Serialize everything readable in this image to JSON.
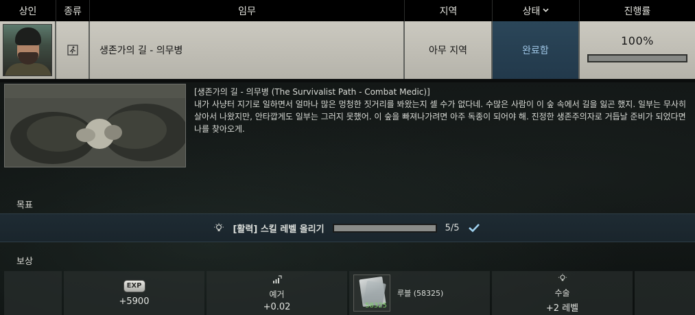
{
  "header": {
    "trader": "상인",
    "type": "종류",
    "task": "임무",
    "location": "지역",
    "status": "상태",
    "progress": "진행률"
  },
  "quest": {
    "type_icon": "exit-run-icon",
    "name": "생존가의 길 - 의무병",
    "location": "아무 지역",
    "status": "완료함",
    "progress_text": "100%",
    "progress_fraction": 1.0
  },
  "description": {
    "title": "[생존가의 길 - 의무병 (The Survivalist Path - Combat Medic)]",
    "body": "내가 사냥터 지기로 일하면서 얼마나 많은 멍청한 짓거리를 봐왔는지 셀 수가 없다네. 수많은 사람이 이 숲 속에서 길을 잃곤 했지. 일부는 무사히 살아서 나왔지만, 안타깝게도 일부는 그러지 못했어. 이 숲을 빠져나가려면 아주 독종이 되어야 해. 진정한 생존주의자로 거듭날 준비가 되었다면 나를 찾아오게."
  },
  "objectives": {
    "label": "목표",
    "items": [
      {
        "icon": "lightbulb-icon",
        "text": "[활력] 스킬 레벨 올리기",
        "count": "5/5",
        "progress_fraction": 1.0,
        "done": true
      }
    ]
  },
  "rewards": {
    "label": "보상",
    "exp": {
      "badge": "EXP",
      "value": "+5900"
    },
    "rep": {
      "label": "예거",
      "value": "+0.02"
    },
    "item": {
      "name": "루블 (58325)",
      "count": "58325"
    },
    "skill": {
      "label": "수술",
      "value": "+2 레벨"
    }
  },
  "colors": {
    "status_bg": "#22394b",
    "status_text": "#9ec4e4",
    "objective_bar": "#1e2b33",
    "check": "#9fd1ee",
    "item_count": "#7fcf6a"
  }
}
